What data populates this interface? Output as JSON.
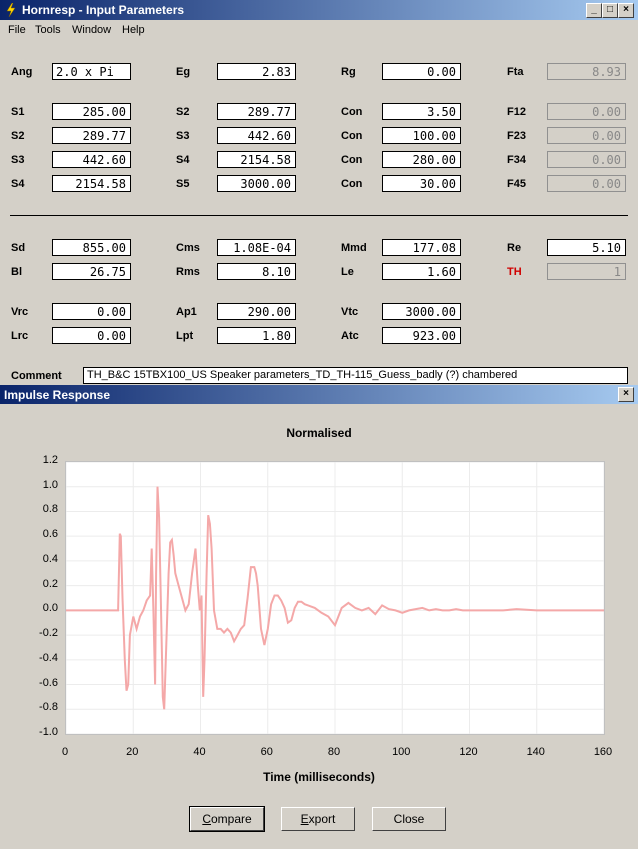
{
  "window1": {
    "title": "Hornresp - Input Parameters",
    "minimize": "_",
    "maximize": "□",
    "close": "×"
  },
  "menu": {
    "file": "File",
    "tools": "Tools",
    "window": "Window",
    "help": "Help"
  },
  "params": {
    "ang": {
      "label": "Ang",
      "value": "2.0 x Pi"
    },
    "eg": {
      "label": "Eg",
      "value": "2.83"
    },
    "rg": {
      "label": "Rg",
      "value": "0.00"
    },
    "fta": {
      "label": "Fta",
      "value": "8.93"
    },
    "s1a": {
      "label": "S1",
      "value": "285.00"
    },
    "s2a": {
      "label": "S2",
      "value": "289.77"
    },
    "con1": {
      "label": "Con",
      "value": "3.50"
    },
    "f12": {
      "label": "F12",
      "value": "0.00"
    },
    "s2b": {
      "label": "S2",
      "value": "289.77"
    },
    "s3a": {
      "label": "S3",
      "value": "442.60"
    },
    "con2": {
      "label": "Con",
      "value": "100.00"
    },
    "f23": {
      "label": "F23",
      "value": "0.00"
    },
    "s3b": {
      "label": "S3",
      "value": "442.60"
    },
    "s4a": {
      "label": "S4",
      "value": "2154.58"
    },
    "con3": {
      "label": "Con",
      "value": "280.00"
    },
    "f34": {
      "label": "F34",
      "value": "0.00"
    },
    "s4b": {
      "label": "S4",
      "value": "2154.58"
    },
    "s5": {
      "label": "S5",
      "value": "3000.00"
    },
    "con4": {
      "label": "Con",
      "value": "30.00"
    },
    "f45": {
      "label": "F45",
      "value": "0.00"
    },
    "sd": {
      "label": "Sd",
      "value": "855.00"
    },
    "cms": {
      "label": "Cms",
      "value": "1.08E-04"
    },
    "mmd": {
      "label": "Mmd",
      "value": "177.08"
    },
    "re": {
      "label": "Re",
      "value": "5.10"
    },
    "bl": {
      "label": "Bl",
      "value": "26.75"
    },
    "rms": {
      "label": "Rms",
      "value": "8.10"
    },
    "le": {
      "label": "Le",
      "value": "1.60"
    },
    "th": {
      "label": "TH",
      "value": "1"
    },
    "vrc": {
      "label": "Vrc",
      "value": "0.00"
    },
    "ap1": {
      "label": "Ap1",
      "value": "290.00"
    },
    "vtc": {
      "label": "Vtc",
      "value": "3000.00"
    },
    "lrc": {
      "label": "Lrc",
      "value": "0.00"
    },
    "lpt": {
      "label": "Lpt",
      "value": "1.80"
    },
    "atc": {
      "label": "Atc",
      "value": "923.00"
    },
    "comment_label": "Comment",
    "comment": "TH_B&C 15TBX100_US Speaker parameters_TD_TH-115_Guess_badly (?) chambered"
  },
  "window2": {
    "title": "Impulse Response",
    "close": "×"
  },
  "buttons": {
    "compare_u": "C",
    "compare_rest": "ompare",
    "export_u": "E",
    "export_rest": "xport",
    "close": "Close"
  },
  "colors": {
    "trace": "#f4a8a8",
    "title_dark": "#0a246a",
    "title_light": "#a6caf0",
    "th_label": "#d00000"
  },
  "chart_data": {
    "type": "line",
    "title": "Normalised",
    "xlabel": "Time (milliseconds)",
    "ylabel": "",
    "xlim": [
      0,
      160
    ],
    "ylim": [
      -1.0,
      1.2
    ],
    "xticks": [
      "0",
      "20",
      "40",
      "60",
      "80",
      "100",
      "120",
      "140",
      "160"
    ],
    "yticks": [
      "1.2",
      "1.0",
      "0.8",
      "0.6",
      "0.4",
      "0.2",
      "0.0",
      "-0.2",
      "-0.4",
      "-0.6",
      "-0.8",
      "-1.0"
    ],
    "grid": true,
    "series": [
      {
        "x": [
          0,
          15.5,
          16,
          16.3,
          16.8,
          17.5,
          18,
          18.5,
          19,
          20,
          21,
          22,
          23,
          24,
          25,
          25.5,
          26,
          26.5,
          26.8,
          27.2,
          27.7,
          28.2,
          28.8,
          29.2,
          29.8,
          30.5,
          31,
          31.5,
          32,
          32.5,
          33.5,
          34.5,
          35.5,
          36.5,
          37.5,
          38.5,
          39.2,
          39.8,
          40.3,
          40.8,
          41.2,
          41.8,
          42.3,
          42.8,
          43.3,
          44,
          45,
          46,
          47,
          48,
          49,
          50,
          51,
          52,
          53,
          54,
          55,
          56,
          56.5,
          57,
          58,
          59,
          60,
          61,
          62,
          63,
          64,
          65,
          66,
          67,
          68,
          69,
          70,
          71,
          72,
          74,
          76,
          78,
          80,
          82,
          84,
          86,
          88,
          90,
          92,
          94,
          96,
          98,
          100,
          102,
          104,
          106,
          108,
          110,
          112,
          114,
          116,
          118,
          120,
          125,
          130,
          134,
          140,
          150,
          160
        ],
        "y": [
          0.0,
          0.0,
          0.62,
          0.6,
          0.1,
          -0.4,
          -0.65,
          -0.6,
          -0.2,
          -0.05,
          -0.15,
          -0.05,
          0.0,
          0.08,
          0.12,
          0.5,
          0.0,
          -0.6,
          0.3,
          1.0,
          0.75,
          0.1,
          -0.7,
          -0.8,
          -0.3,
          0.3,
          0.55,
          0.57,
          0.45,
          0.3,
          0.2,
          0.1,
          0.0,
          0.05,
          0.3,
          0.5,
          0.2,
          0.0,
          0.12,
          -0.7,
          -0.4,
          0.3,
          0.77,
          0.7,
          0.5,
          0.0,
          -0.15,
          -0.15,
          -0.18,
          -0.15,
          -0.18,
          -0.25,
          -0.2,
          -0.15,
          -0.12,
          0.1,
          0.35,
          0.35,
          0.3,
          0.2,
          -0.15,
          -0.28,
          -0.15,
          0.05,
          0.12,
          0.12,
          0.08,
          0.02,
          -0.1,
          -0.08,
          0.02,
          0.07,
          0.07,
          0.05,
          0.04,
          0.02,
          -0.02,
          -0.05,
          -0.12,
          0.02,
          0.06,
          0.02,
          0.0,
          0.02,
          -0.03,
          0.04,
          0.01,
          0.0,
          -0.02,
          0.0,
          0.01,
          0.02,
          0.0,
          0.01,
          0.0,
          0.0,
          0.01,
          0.0,
          0.0,
          0.0,
          0.0,
          0.01,
          0.0,
          0.0,
          0.0
        ]
      }
    ]
  }
}
